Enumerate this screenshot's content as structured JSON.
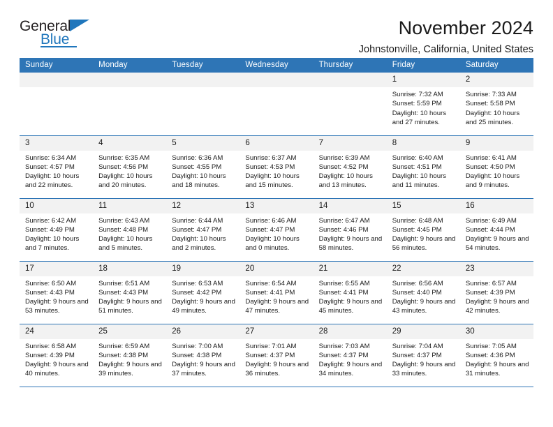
{
  "brand": {
    "word_one": "General",
    "word_two": "Blue",
    "accent_color": "#1f76bc"
  },
  "header": {
    "title": "November 2024",
    "subtitle": "Johnstonville, California, United States",
    "header_bg": "#2e75b6",
    "daynum_bg": "#f2f2f2"
  },
  "weekday_headers": [
    "Sunday",
    "Monday",
    "Tuesday",
    "Wednesday",
    "Thursday",
    "Friday",
    "Saturday"
  ],
  "labels": {
    "sunrise": "Sunrise:",
    "sunset": "Sunset:",
    "daylight": "Daylight:"
  },
  "weeks": [
    [
      {
        "day": "",
        "sunrise": "",
        "sunset": "",
        "daylight": "",
        "empty": true
      },
      {
        "day": "",
        "sunrise": "",
        "sunset": "",
        "daylight": "",
        "empty": true
      },
      {
        "day": "",
        "sunrise": "",
        "sunset": "",
        "daylight": "",
        "empty": true
      },
      {
        "day": "",
        "sunrise": "",
        "sunset": "",
        "daylight": "",
        "empty": true
      },
      {
        "day": "",
        "sunrise": "",
        "sunset": "",
        "daylight": "",
        "empty": true
      },
      {
        "day": "1",
        "sunrise": "Sunrise: 7:32 AM",
        "sunset": "Sunset: 5:59 PM",
        "daylight": "Daylight: 10 hours and 27 minutes.",
        "empty": false
      },
      {
        "day": "2",
        "sunrise": "Sunrise: 7:33 AM",
        "sunset": "Sunset: 5:58 PM",
        "daylight": "Daylight: 10 hours and 25 minutes.",
        "empty": false
      }
    ],
    [
      {
        "day": "3",
        "sunrise": "Sunrise: 6:34 AM",
        "sunset": "Sunset: 4:57 PM",
        "daylight": "Daylight: 10 hours and 22 minutes.",
        "empty": false
      },
      {
        "day": "4",
        "sunrise": "Sunrise: 6:35 AM",
        "sunset": "Sunset: 4:56 PM",
        "daylight": "Daylight: 10 hours and 20 minutes.",
        "empty": false
      },
      {
        "day": "5",
        "sunrise": "Sunrise: 6:36 AM",
        "sunset": "Sunset: 4:55 PM",
        "daylight": "Daylight: 10 hours and 18 minutes.",
        "empty": false
      },
      {
        "day": "6",
        "sunrise": "Sunrise: 6:37 AM",
        "sunset": "Sunset: 4:53 PM",
        "daylight": "Daylight: 10 hours and 15 minutes.",
        "empty": false
      },
      {
        "day": "7",
        "sunrise": "Sunrise: 6:39 AM",
        "sunset": "Sunset: 4:52 PM",
        "daylight": "Daylight: 10 hours and 13 minutes.",
        "empty": false
      },
      {
        "day": "8",
        "sunrise": "Sunrise: 6:40 AM",
        "sunset": "Sunset: 4:51 PM",
        "daylight": "Daylight: 10 hours and 11 minutes.",
        "empty": false
      },
      {
        "day": "9",
        "sunrise": "Sunrise: 6:41 AM",
        "sunset": "Sunset: 4:50 PM",
        "daylight": "Daylight: 10 hours and 9 minutes.",
        "empty": false
      }
    ],
    [
      {
        "day": "10",
        "sunrise": "Sunrise: 6:42 AM",
        "sunset": "Sunset: 4:49 PM",
        "daylight": "Daylight: 10 hours and 7 minutes.",
        "empty": false
      },
      {
        "day": "11",
        "sunrise": "Sunrise: 6:43 AM",
        "sunset": "Sunset: 4:48 PM",
        "daylight": "Daylight: 10 hours and 5 minutes.",
        "empty": false
      },
      {
        "day": "12",
        "sunrise": "Sunrise: 6:44 AM",
        "sunset": "Sunset: 4:47 PM",
        "daylight": "Daylight: 10 hours and 2 minutes.",
        "empty": false
      },
      {
        "day": "13",
        "sunrise": "Sunrise: 6:46 AM",
        "sunset": "Sunset: 4:47 PM",
        "daylight": "Daylight: 10 hours and 0 minutes.",
        "empty": false
      },
      {
        "day": "14",
        "sunrise": "Sunrise: 6:47 AM",
        "sunset": "Sunset: 4:46 PM",
        "daylight": "Daylight: 9 hours and 58 minutes.",
        "empty": false
      },
      {
        "day": "15",
        "sunrise": "Sunrise: 6:48 AM",
        "sunset": "Sunset: 4:45 PM",
        "daylight": "Daylight: 9 hours and 56 minutes.",
        "empty": false
      },
      {
        "day": "16",
        "sunrise": "Sunrise: 6:49 AM",
        "sunset": "Sunset: 4:44 PM",
        "daylight": "Daylight: 9 hours and 54 minutes.",
        "empty": false
      }
    ],
    [
      {
        "day": "17",
        "sunrise": "Sunrise: 6:50 AM",
        "sunset": "Sunset: 4:43 PM",
        "daylight": "Daylight: 9 hours and 53 minutes.",
        "empty": false
      },
      {
        "day": "18",
        "sunrise": "Sunrise: 6:51 AM",
        "sunset": "Sunset: 4:43 PM",
        "daylight": "Daylight: 9 hours and 51 minutes.",
        "empty": false
      },
      {
        "day": "19",
        "sunrise": "Sunrise: 6:53 AM",
        "sunset": "Sunset: 4:42 PM",
        "daylight": "Daylight: 9 hours and 49 minutes.",
        "empty": false
      },
      {
        "day": "20",
        "sunrise": "Sunrise: 6:54 AM",
        "sunset": "Sunset: 4:41 PM",
        "daylight": "Daylight: 9 hours and 47 minutes.",
        "empty": false
      },
      {
        "day": "21",
        "sunrise": "Sunrise: 6:55 AM",
        "sunset": "Sunset: 4:41 PM",
        "daylight": "Daylight: 9 hours and 45 minutes.",
        "empty": false
      },
      {
        "day": "22",
        "sunrise": "Sunrise: 6:56 AM",
        "sunset": "Sunset: 4:40 PM",
        "daylight": "Daylight: 9 hours and 43 minutes.",
        "empty": false
      },
      {
        "day": "23",
        "sunrise": "Sunrise: 6:57 AM",
        "sunset": "Sunset: 4:39 PM",
        "daylight": "Daylight: 9 hours and 42 minutes.",
        "empty": false
      }
    ],
    [
      {
        "day": "24",
        "sunrise": "Sunrise: 6:58 AM",
        "sunset": "Sunset: 4:39 PM",
        "daylight": "Daylight: 9 hours and 40 minutes.",
        "empty": false
      },
      {
        "day": "25",
        "sunrise": "Sunrise: 6:59 AM",
        "sunset": "Sunset: 4:38 PM",
        "daylight": "Daylight: 9 hours and 39 minutes.",
        "empty": false
      },
      {
        "day": "26",
        "sunrise": "Sunrise: 7:00 AM",
        "sunset": "Sunset: 4:38 PM",
        "daylight": "Daylight: 9 hours and 37 minutes.",
        "empty": false
      },
      {
        "day": "27",
        "sunrise": "Sunrise: 7:01 AM",
        "sunset": "Sunset: 4:37 PM",
        "daylight": "Daylight: 9 hours and 36 minutes.",
        "empty": false
      },
      {
        "day": "28",
        "sunrise": "Sunrise: 7:03 AM",
        "sunset": "Sunset: 4:37 PM",
        "daylight": "Daylight: 9 hours and 34 minutes.",
        "empty": false
      },
      {
        "day": "29",
        "sunrise": "Sunrise: 7:04 AM",
        "sunset": "Sunset: 4:37 PM",
        "daylight": "Daylight: 9 hours and 33 minutes.",
        "empty": false
      },
      {
        "day": "30",
        "sunrise": "Sunrise: 7:05 AM",
        "sunset": "Sunset: 4:36 PM",
        "daylight": "Daylight: 9 hours and 31 minutes.",
        "empty": false
      }
    ]
  ]
}
